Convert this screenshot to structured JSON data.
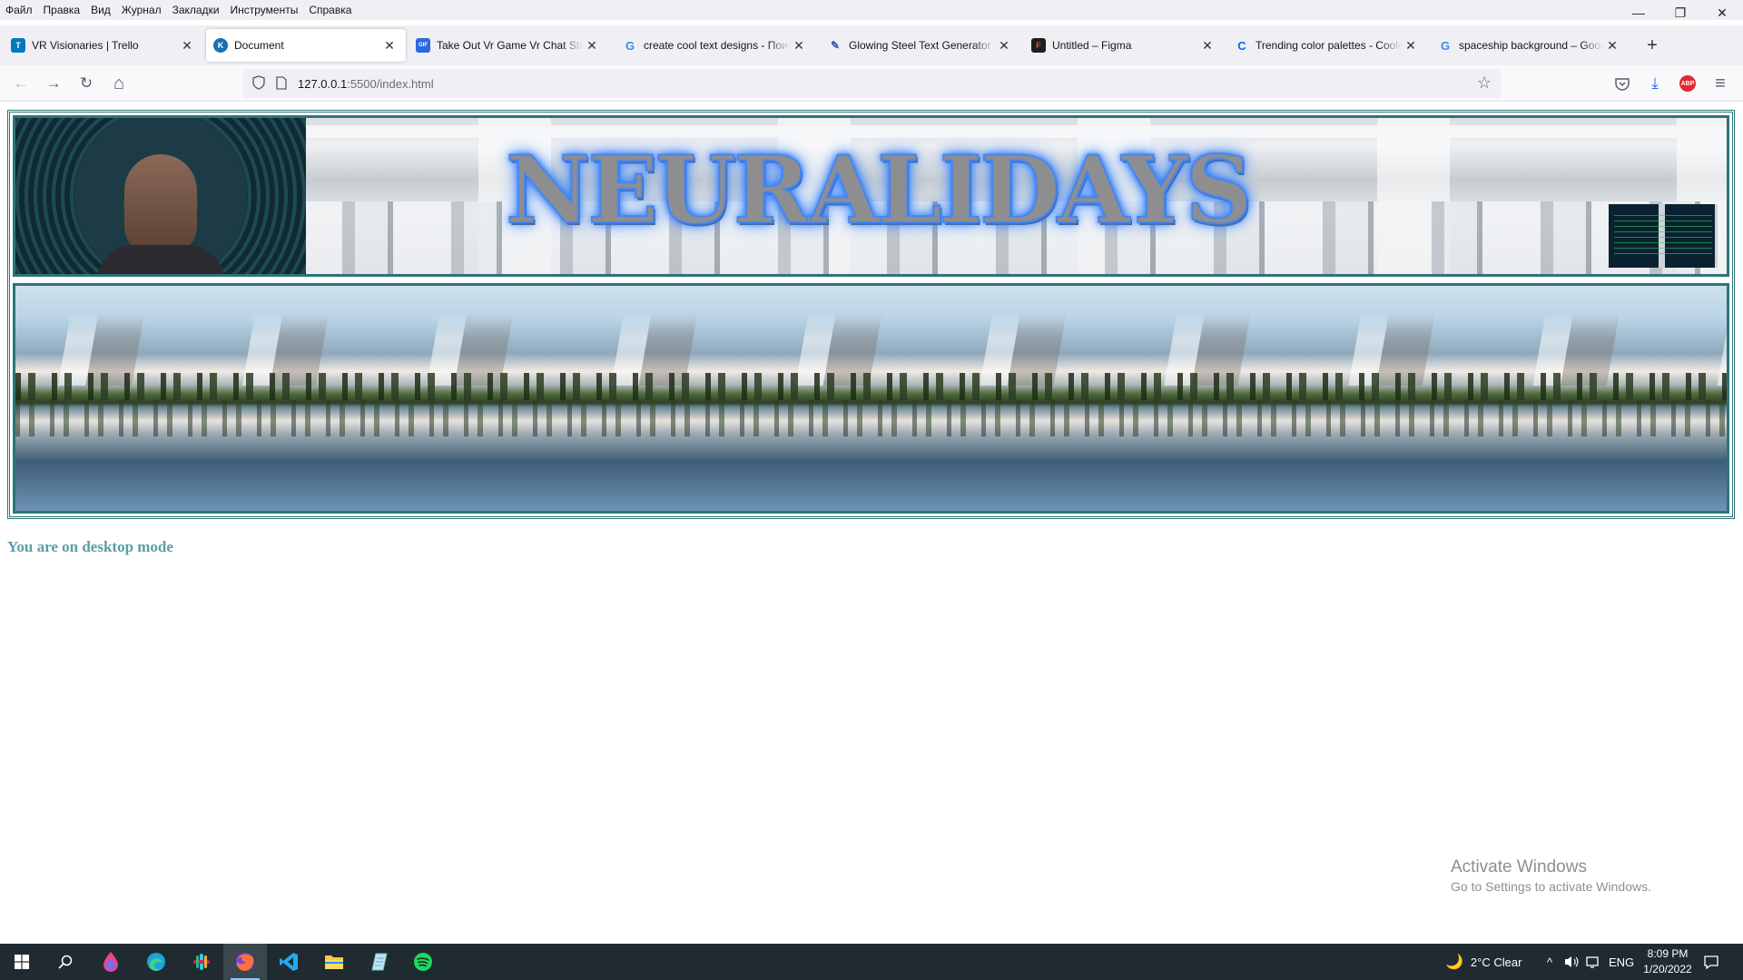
{
  "menubar": {
    "items": [
      "Файл",
      "Правка",
      "Вид",
      "Журнал",
      "Закладки",
      "Инструменты",
      "Справка"
    ]
  },
  "window_controls": {
    "minimize": "—",
    "restore": "❐",
    "close": "✕"
  },
  "tabs": [
    {
      "title": "VR Visionaries | Trello",
      "icon": "trello-icon",
      "color": "#0079bf",
      "glyph": "T"
    },
    {
      "title": "Document",
      "icon": "vscode-live-server-icon",
      "color": "#1a6fb4",
      "glyph": "K",
      "active": true
    },
    {
      "title": "Take Out Vr Game Vr Chat Sticker",
      "icon": "gif-icon",
      "color": "#2a6ae0",
      "glyph": "GIF"
    },
    {
      "title": "create cool text designs - Поиск в Google",
      "icon": "google-icon",
      "color": "#ffffff",
      "glyph": "G"
    },
    {
      "title": "Glowing Steel Text Generator",
      "icon": "flamingtext-icon",
      "color": "#ffffff",
      "glyph": "✎"
    },
    {
      "title": "Untitled – Figma",
      "icon": "figma-icon",
      "color": "#1e1e1e",
      "glyph": "F"
    },
    {
      "title": "Trending color palettes - Coolors",
      "icon": "coolors-icon",
      "color": "#ffffff",
      "glyph": "C"
    },
    {
      "title": "spaceship background – Google Search",
      "icon": "google-icon",
      "color": "#ffffff",
      "glyph": "G"
    }
  ],
  "newtab": "+",
  "navbar": {
    "back": "←",
    "forward": "→",
    "reload": "↻",
    "home": "⌂",
    "url_host": "127.0.0.1",
    "url_path": ":5500/index.html",
    "bookmark_star": "☆",
    "pocket": "◫",
    "downloads": "⤓",
    "abp": "ABP",
    "menu": "≡"
  },
  "page": {
    "header_title": "NEURALIDAYS",
    "status_message": "You are on desktop mode",
    "accent_color": "#2e7478",
    "message_color": "#5a9ea4"
  },
  "watermark": {
    "line1": "Activate Windows",
    "line2": "Go to Settings to activate Windows."
  },
  "taskbar": {
    "weather_icon": "🌙",
    "weather": "2°C  Clear",
    "tray_chevron": "^",
    "language": "ENG",
    "time": "8:09 PM",
    "date": "1/20/2022",
    "apps": [
      "start-icon",
      "search-icon",
      "figma-app-icon",
      "edge-icon",
      "slack-icon",
      "firefox-icon",
      "vscode-icon",
      "file-explorer-icon",
      "notepad-icon",
      "spotify-icon"
    ]
  }
}
